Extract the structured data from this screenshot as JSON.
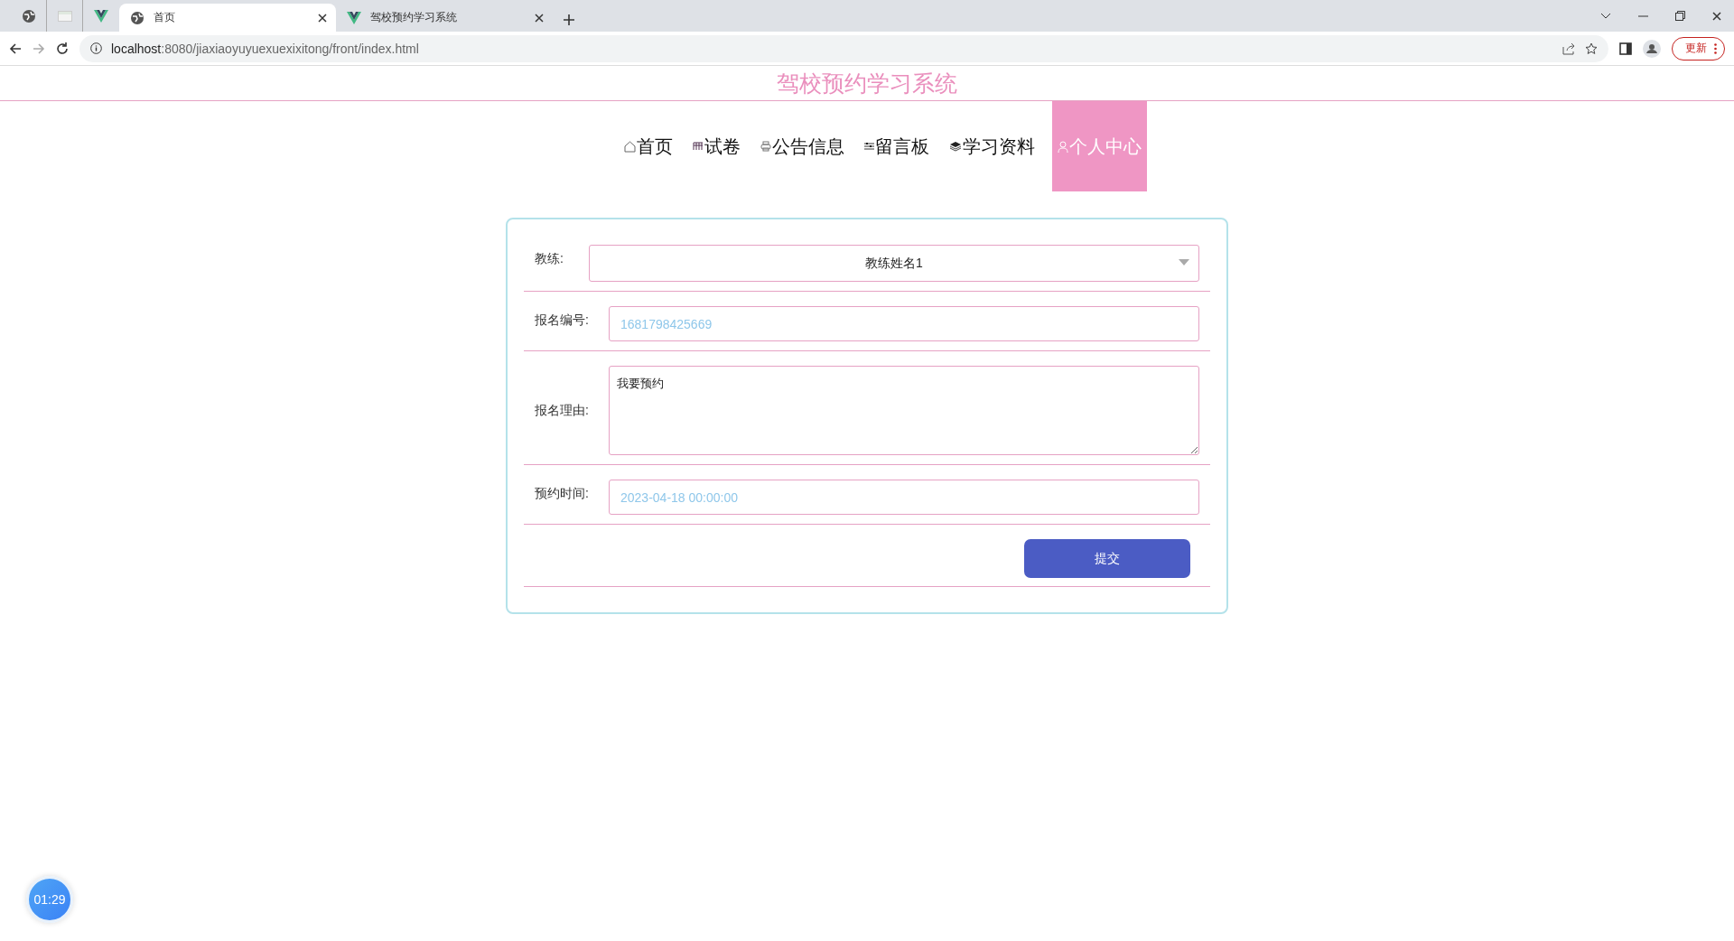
{
  "browser": {
    "pinned_tabs": [
      {
        "selected": false
      },
      {
        "selected": false
      },
      {
        "selected": false
      }
    ],
    "tabs": [
      {
        "title": "首页",
        "selected": true
      },
      {
        "title": "驾校预约学习系统",
        "selected": false
      }
    ],
    "address": {
      "host": "localhost",
      "rest": ":8080/jiaxiaoyuyuexuexixitong/front/index.html"
    },
    "update_button": "更新"
  },
  "site_title": "驾校预约学习系统",
  "nav": [
    {
      "label": "首页",
      "selected": false
    },
    {
      "label": "试卷",
      "selected": false
    },
    {
      "label": "公告信息",
      "selected": false
    },
    {
      "label": "留言板",
      "selected": false
    },
    {
      "label": "学习资料",
      "selected": false
    },
    {
      "label": "个人中心",
      "selected": true
    }
  ],
  "form": {
    "fields": [
      {
        "kind": "select",
        "label": "教练:",
        "value": "教练姓名1"
      },
      {
        "kind": "input",
        "label": "报名编号:",
        "value": "1681798425669",
        "readonly": true
      },
      {
        "kind": "textarea",
        "label": "报名理由:",
        "value": "我要预约",
        "readonly": false
      },
      {
        "kind": "input",
        "label": "预约时间:",
        "value": "2023-04-18 00:00:00",
        "readonly": true
      }
    ],
    "submit": "提交"
  },
  "timer": "01:29"
}
